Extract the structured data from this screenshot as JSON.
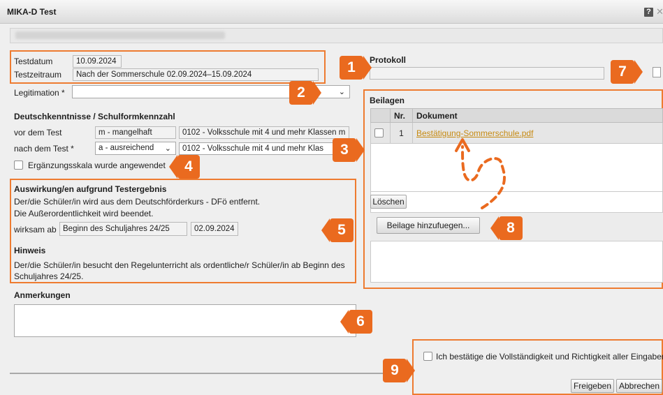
{
  "window": {
    "title": "MIKA-D Test",
    "help_label": "?",
    "close_label": "✕"
  },
  "test": {
    "testdatum_label": "Testdatum",
    "testdatum_value": "10.09.2024",
    "testzeitraum_label": "Testzeitraum",
    "testzeitraum_value": "Nach der Sommerschule 02.09.2024–15.09.2024",
    "legitimation_label": "Legitimation *",
    "legitimation_value": ""
  },
  "deutsch": {
    "section_title": "Deutschkenntnisse / Schulformkennzahl",
    "vor_label": "vor dem Test",
    "vor_grade": "m - mangelhaft",
    "vor_school": "0102 - Volksschule mit 4 und mehr Klassen m",
    "nach_label": "nach dem Test *",
    "nach_grade": "a - ausreichend",
    "nach_school": "0102 - Volksschule mit 4 und mehr Klas",
    "ergaenzung_label": "Ergänzungsskala wurde angewendet"
  },
  "auswirkung": {
    "title": "Auswirkung/en aufgrund Testergebnis",
    "line1": "Der/die Schüler/in wird aus dem Deutschförderkurs - DFö entfernt.",
    "line2": "Die Außerordentlichkeit wird beendet.",
    "wirksam_label": "wirksam ab",
    "wirksam_value": "Beginn des Schuljahres 24/25",
    "wirksam_date": "02.09.2024",
    "hinweis_title": "Hinweis",
    "hinweis_line1": "Der/die Schüler/in besucht den Regelunterricht als ordentliche/r Schüler/in ab Beginn des",
    "hinweis_line2": "Schuljahres 24/25."
  },
  "anmerkungen": {
    "label": "Anmerkungen",
    "value": ""
  },
  "protokoll": {
    "label": "Protokoll",
    "value": ""
  },
  "beilagen": {
    "title": "Beilagen",
    "col_nr": "Nr.",
    "col_dokument": "Dokument",
    "rows": [
      {
        "nr": "1",
        "dokument": "Bestätigung-Sommerschule.pdf"
      }
    ],
    "delete_label": "Löschen",
    "add_label": "Beilage hinzufuegen..."
  },
  "confirm": {
    "label": "Ich bestätige die Vollständigkeit und Richtigkeit aller Eingaben.",
    "release_label": "Freigeben",
    "cancel_label": "Abbrechen"
  },
  "badges": [
    "1",
    "2",
    "3",
    "4",
    "5",
    "6",
    "7",
    "8",
    "9"
  ],
  "colors": {
    "callout": "#ea6a1f",
    "link": "#c68a12"
  }
}
